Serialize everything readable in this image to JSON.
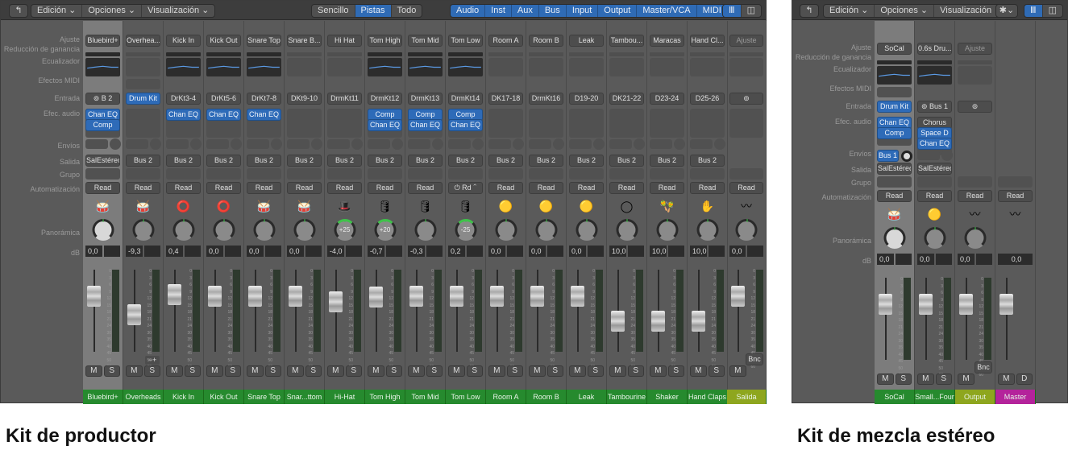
{
  "captions": {
    "left": "Kit de productor",
    "right": "Kit de mezcla estéreo"
  },
  "toolbar": {
    "menus": [
      "Edición",
      "Opciones",
      "Visualización"
    ],
    "view_modes": [
      "Sencillo",
      "Pistas",
      "Todo"
    ],
    "active_view": "Pistas",
    "filters": [
      "Audio",
      "Inst",
      "Aux",
      "Bus",
      "Input",
      "Output",
      "Master/VCA",
      "MIDI"
    ]
  },
  "row_labels": {
    "ajuste": "Ajuste",
    "reduccion": "Reducción de ganancia",
    "eq": "Ecualizador",
    "midi": "Efectos MIDI",
    "entrada": "Entrada",
    "efec": "Efec. audio",
    "envios": "Envíos",
    "salida": "Salida",
    "grupo": "Grupo",
    "auto": "Automatización",
    "pan": "Panorámica",
    "db": "dB"
  },
  "producer": {
    "strips": [
      {
        "setting": "Bluebird+",
        "input": "B 2",
        "input_link": true,
        "fx": [
          "Chan EQ",
          "Comp"
        ],
        "output": "SalEstéreo",
        "auto": "Read",
        "db": "0,0",
        "pan": "",
        "name": "Bluebird+",
        "icon": "drum-kit",
        "eq": true,
        "fader": 0.75,
        "sel": true
      },
      {
        "setting": "Overhea...",
        "input": "Drum Kit",
        "input_blue": true,
        "fx": [],
        "output": "Bus 2",
        "auto": "Read",
        "db": "-9,3",
        "pan": "",
        "name": "Overheads",
        "icon": "drum-kit",
        "fader": 0.45,
        "midi": true
      },
      {
        "setting": "Kick In",
        "input": "DrKt3-4",
        "fx": [
          "Chan EQ"
        ],
        "output": "Bus 2",
        "auto": "Read",
        "db": "0,4",
        "pan": "",
        "name": "Kick In",
        "icon": "kick-drum",
        "eq": true,
        "fader": 0.77
      },
      {
        "setting": "Kick Out",
        "input": "DrKt5-6",
        "fx": [
          "Chan EQ"
        ],
        "output": "Bus 2",
        "auto": "Read",
        "db": "0,0",
        "pan": "",
        "name": "Kick Out",
        "icon": "kick-drum",
        "eq": true,
        "fader": 0.75
      },
      {
        "setting": "Snare Top",
        "input": "DrKt7-8",
        "fx": [
          "Chan EQ"
        ],
        "output": "Bus 2",
        "auto": "Read",
        "db": "0,0",
        "pan": "",
        "name": "Snare Top",
        "icon": "snare",
        "eq": true,
        "fader": 0.75
      },
      {
        "setting": "Snare B...",
        "input": "DKt9-10",
        "fx": [],
        "output": "Bus 2",
        "auto": "Read",
        "db": "0,0",
        "pan": "",
        "name": "Snar...ttom",
        "icon": "snare",
        "fader": 0.75
      },
      {
        "setting": "Hi Hat",
        "input": "DrmKt11",
        "fx": [],
        "output": "Bus 2",
        "auto": "Read",
        "db": "-4,0",
        "pan": "+25",
        "name": "Hi-Hat",
        "icon": "hi-hat",
        "fader": 0.66
      },
      {
        "setting": "Tom High",
        "input": "DrmKt12",
        "fx": [
          "Comp",
          "Chan EQ"
        ],
        "output": "Bus 2",
        "auto": "Read",
        "db": "-0,7",
        "pan": "+20",
        "name": "Tom High",
        "icon": "tom",
        "eq": true,
        "fader": 0.73
      },
      {
        "setting": "Tom Mid",
        "input": "DrmKt13",
        "fx": [
          "Comp",
          "Chan EQ"
        ],
        "output": "Bus 2",
        "auto": "Read",
        "db": "-0,3",
        "pan": "",
        "name": "Tom Mid",
        "icon": "tom",
        "eq": true,
        "fader": 0.74
      },
      {
        "setting": "Tom Low",
        "input": "DrmKt14",
        "fx": [
          "Comp",
          "Chan EQ"
        ],
        "output": "Bus 2",
        "auto": "Rd",
        "db": "0,2",
        "pan": "-25",
        "name": "Tom Low",
        "icon": "tom",
        "eq": true,
        "fader": 0.75
      },
      {
        "setting": "Room A",
        "input": "DK17-18",
        "fx": [],
        "output": "Bus 2",
        "auto": "Read",
        "db": "0,0",
        "pan": "",
        "name": "Room A",
        "icon": "room-mic",
        "fader": 0.75
      },
      {
        "setting": "Room B",
        "input": "DrmKt16",
        "fx": [],
        "output": "Bus 2",
        "auto": "Read",
        "db": "0,0",
        "pan": "",
        "name": "Room B",
        "icon": "room-mic",
        "fader": 0.75
      },
      {
        "setting": "Leak",
        "input": "D19-20",
        "fx": [],
        "output": "Bus 2",
        "auto": "Read",
        "db": "0,0",
        "pan": "",
        "name": "Leak",
        "icon": "room-mic",
        "fader": 0.75
      },
      {
        "setting": "Tambou...",
        "input": "DK21-22",
        "fx": [],
        "output": "Bus 2",
        "auto": "Read",
        "db": "10,0",
        "pan": "",
        "name": "Tambourine",
        "icon": "tambourine",
        "fader": 0.35
      },
      {
        "setting": "Maracas",
        "input": "D23-24",
        "fx": [],
        "output": "Bus 2",
        "auto": "Read",
        "db": "10,0",
        "pan": "",
        "name": "Shaker",
        "icon": "maracas",
        "fader": 0.35
      },
      {
        "setting": "Hand Cl...",
        "input": "D25-26",
        "fx": [],
        "output": "Bus 2",
        "auto": "Read",
        "db": "10,0",
        "pan": "",
        "name": "Hand Claps",
        "icon": "hand",
        "fader": 0.35
      },
      {
        "setting": "Ajuste",
        "input": "",
        "input_link": true,
        "fx": [],
        "output": "",
        "auto": "Read",
        "db": "0,0",
        "pan": "",
        "name": "Salida",
        "icon": "waveform",
        "fader": 0.75,
        "out": true,
        "bnc": "Bnc"
      }
    ]
  },
  "stereo": {
    "strips": [
      {
        "setting": "SoCal",
        "input": "Drum Kit",
        "input_blue": true,
        "fx": [
          "Chan EQ",
          "Comp"
        ],
        "send": "Bus 1",
        "output": "SalEstéreo",
        "auto": "Read",
        "db": "0,0",
        "name": "SoCal",
        "icon": "drum-kit",
        "eq": true,
        "sel": true,
        "midi": true,
        "fader": 0.75
      },
      {
        "setting": "0.6s Dru...",
        "input": "Bus 1",
        "input_link": true,
        "fx": [
          "Chorus",
          "Space D",
          "Chan EQ"
        ],
        "fx_gray0": true,
        "output": "SalEstéreo",
        "auto": "Read",
        "db": "0,0",
        "name": "Small...Four",
        "icon": "room-mic",
        "eq": true,
        "fader": 0.75
      },
      {
        "setting": "Ajuste",
        "input": "",
        "input_link": true,
        "fx": [],
        "output": "",
        "auto": "Read",
        "db": "0,0",
        "name": "Output",
        "icon": "waveform",
        "out": true,
        "bnc": "Bnc",
        "fader": 0.75
      },
      {
        "setting": "",
        "fx": [],
        "auto": "Read",
        "db": "0,0",
        "name": "Master",
        "icon": "waveform",
        "master": true,
        "fader": 0.75
      }
    ]
  },
  "buttons": {
    "m": "M",
    "s": "S",
    "d": "D"
  },
  "colors": {
    "track": "#268a2e",
    "output": "#8ea61e",
    "master": "#b4239b",
    "blue": "#2e6bb8"
  }
}
